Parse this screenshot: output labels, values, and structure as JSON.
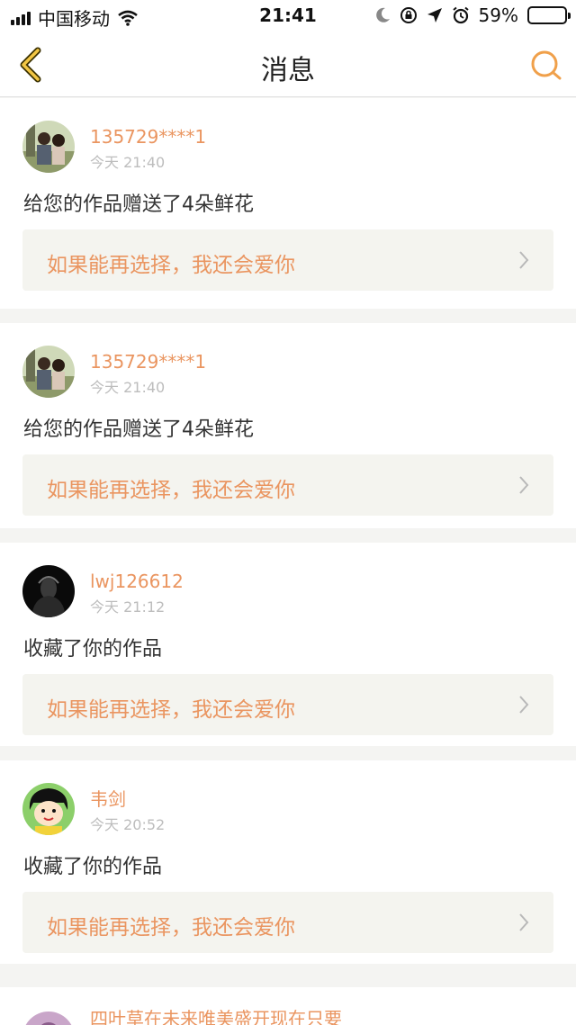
{
  "status_bar": {
    "carrier": "中国移动",
    "time": "21:41",
    "battery": "59%",
    "battery_level": 0.59,
    "icons": [
      "signal-icon",
      "wifi-icon",
      "moon-icon",
      "rotation-lock-icon",
      "location-icon",
      "alarm-icon",
      "battery-icon"
    ]
  },
  "nav": {
    "title": "消息",
    "back_icon": "chevron-left-icon",
    "search_icon": "search-icon",
    "accent": "#f0a04a"
  },
  "colors": {
    "accent_orange": "#ea9560",
    "background": "#f4f4f2",
    "card_link_bg": "#f4f4ef"
  },
  "messages": [
    {
      "username": "135729****1",
      "time": "今天 21:40",
      "action": "给您的作品赠送了4朵鲜花",
      "work_title": "如果能再选择，我还会爱你"
    },
    {
      "username": "135729****1",
      "time": "今天 21:40",
      "action": "给您的作品赠送了4朵鲜花",
      "work_title": "如果能再选择，我还会爱你"
    },
    {
      "username": "lwj126612",
      "time": "今天 21:12",
      "action": "收藏了你的作品",
      "work_title": "如果能再选择，我还会爱你"
    },
    {
      "username": "韦剑",
      "time": "今天 20:52",
      "action": "收藏了你的作品",
      "work_title": "如果能再选择，我还会爱你"
    },
    {
      "username": "四叶草在未来唯美盛开现在只要"
    }
  ]
}
